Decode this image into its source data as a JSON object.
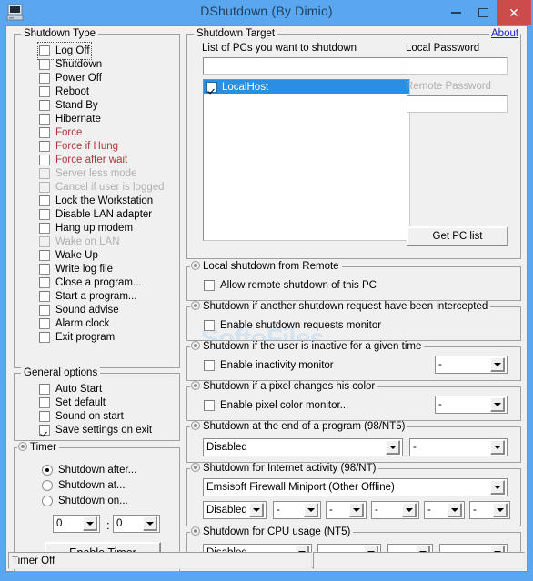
{
  "window": {
    "title": "DShutdown (By Dimio)",
    "icon": "computer-icon",
    "minimize": "–",
    "maximize": "□",
    "close": "✕",
    "titlebar_color": "#5aa7f0",
    "close_color": "#cc4b4b"
  },
  "watermark": "SoftoFiles",
  "shutdown_type": {
    "caption": "Shutdown Type",
    "items": [
      {
        "label": "Log Off",
        "checked": false,
        "state": "focused"
      },
      {
        "label": "Shutdown",
        "checked": false,
        "state": "normal"
      },
      {
        "label": "Power Off",
        "checked": false,
        "state": "normal"
      },
      {
        "label": "Reboot",
        "checked": false,
        "state": "normal"
      },
      {
        "label": "Stand By",
        "checked": false,
        "state": "normal"
      },
      {
        "label": "Hibernate",
        "checked": false,
        "state": "normal"
      },
      {
        "label": "Force",
        "checked": false,
        "state": "red"
      },
      {
        "label": "Force if Hung",
        "checked": false,
        "state": "red"
      },
      {
        "label": "Force after wait",
        "checked": false,
        "state": "red"
      },
      {
        "label": "Server less mode",
        "checked": false,
        "state": "disabled"
      },
      {
        "label": "Cancel if user is logged",
        "checked": false,
        "state": "disabled"
      },
      {
        "label": "Lock the Workstation",
        "checked": false,
        "state": "normal"
      },
      {
        "label": "Disable LAN adapter",
        "checked": false,
        "state": "normal"
      },
      {
        "label": "Hang up modem",
        "checked": false,
        "state": "normal"
      },
      {
        "label": "Wake on LAN",
        "checked": false,
        "state": "disabled"
      },
      {
        "label": "Wake Up",
        "checked": false,
        "state": "normal"
      },
      {
        "label": "Write log file",
        "checked": false,
        "state": "normal"
      },
      {
        "label": "Close a program...",
        "checked": false,
        "state": "normal"
      },
      {
        "label": "Start a program...",
        "checked": false,
        "state": "normal"
      },
      {
        "label": "Sound advise",
        "checked": false,
        "state": "normal"
      },
      {
        "label": "Alarm clock",
        "checked": false,
        "state": "normal"
      },
      {
        "label": "Exit program",
        "checked": false,
        "state": "normal"
      }
    ]
  },
  "general_options": {
    "caption": "General options",
    "items": [
      {
        "label": "Auto Start",
        "checked": false
      },
      {
        "label": "Set default",
        "checked": false
      },
      {
        "label": "Sound on start",
        "checked": false
      },
      {
        "label": "Save settings on exit",
        "checked": true
      }
    ]
  },
  "timer": {
    "caption": "Timer",
    "radios": [
      {
        "label": "Shutdown after...",
        "checked": true
      },
      {
        "label": "Shutdown at...",
        "checked": false
      },
      {
        "label": "Shutdown on...",
        "checked": false
      }
    ],
    "hours": "0",
    "separator": ":",
    "minutes": "0",
    "button": "Enable Timer"
  },
  "shutdown_target": {
    "caption": "Shutdown Target",
    "about": "About",
    "pc_list_label": "List of PCs you want to shutdown",
    "pc_filter_value": "",
    "pc_list": [
      {
        "label": "LocalHost",
        "checked": true,
        "selected": true
      }
    ],
    "local_password_label": "Local Password",
    "local_password_value": "",
    "remote_password_label": "Remote Password",
    "remote_password_value": "",
    "remote_password_disabled": true,
    "get_pc_list_button": "Get PC list"
  },
  "local_remote": {
    "caption": "Local shutdown from Remote",
    "checkbox": {
      "label": "Allow remote shutdown of this PC",
      "checked": false
    }
  },
  "intercepted": {
    "caption": "Shutdown if another shutdown request have been intercepted",
    "checkbox": {
      "label": "Enable shutdown requests monitor",
      "checked": false
    }
  },
  "inactivity": {
    "caption": "Shutdown if the user is inactive for a given time",
    "checkbox": {
      "label": "Enable inactivity monitor",
      "checked": false
    },
    "combo": "-"
  },
  "pixel_color": {
    "caption": "Shutdown if a pixel changes his color",
    "checkbox": {
      "label": "Enable pixel color monitor...",
      "checked": false
    },
    "combo": "-"
  },
  "end_of_program": {
    "caption": "Shutdown at the end of a program (98/NT5)",
    "combo_main": "Disabled",
    "combo_2": "-"
  },
  "internet_activity": {
    "caption": "Shutdown for Internet activity (98/NT)",
    "adapter": "Emsisoft Firewall Miniport (Other Offline)",
    "combos": [
      "Disabled",
      "-",
      "-",
      "-",
      "-",
      "-"
    ]
  },
  "cpu_usage": {
    "caption": "Shutdown for CPU usage (NT5)",
    "combos": [
      "Disabled",
      "-",
      "-",
      "-"
    ]
  },
  "statusbar": {
    "panel1": "Timer Off",
    "panel2": ""
  }
}
